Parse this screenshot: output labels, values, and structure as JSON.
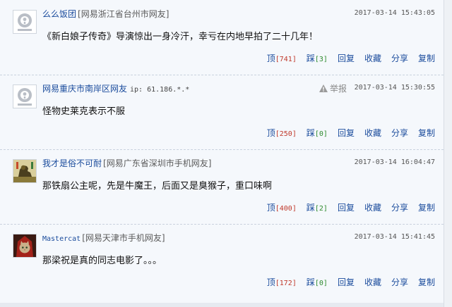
{
  "actions": {
    "up": "顶",
    "down": "踩",
    "reply": "回复",
    "favorite": "收藏",
    "share": "分享",
    "copy": "复制",
    "report": "举报"
  },
  "comments": [
    {
      "user": "么么饭团",
      "location": "[网易浙江省台州市网友]",
      "ip": "",
      "time": "2017-03-14 15:43:05",
      "text": "《新白娘子传奇》导演惊出一身冷汗，幸亏在内地早拍了二十几年！",
      "up": "[741]",
      "down": "[3]",
      "avatar": "default-avatar"
    },
    {
      "user": "网易重庆市南岸区网友",
      "location": "",
      "ip": "ip: 61.186.*.*",
      "time": "2017-03-14 15:30:55",
      "text": "怪物史莱克表示不服",
      "up": "[250]",
      "down": "[0]",
      "avatar": "default-avatar"
    },
    {
      "user": "我才是俗不可耐",
      "location": "[网易广东省深圳市手机网友]",
      "ip": "",
      "time": "2017-03-14 16:04:47",
      "text": "那铁扇公主呢，先是牛魔王，后面又是臭猴子，重口味啊",
      "up": "[400]",
      "down": "[2]",
      "avatar": "lion-avatar"
    },
    {
      "user": "Mastercat",
      "location": "[网易天津市手机网友]",
      "ip": "",
      "time": "2017-03-14 15:41:45",
      "text": "那梁祝是真的同志电影了。。。",
      "up": "[172]",
      "down": "[0]",
      "avatar": "cat-avatar"
    }
  ]
}
